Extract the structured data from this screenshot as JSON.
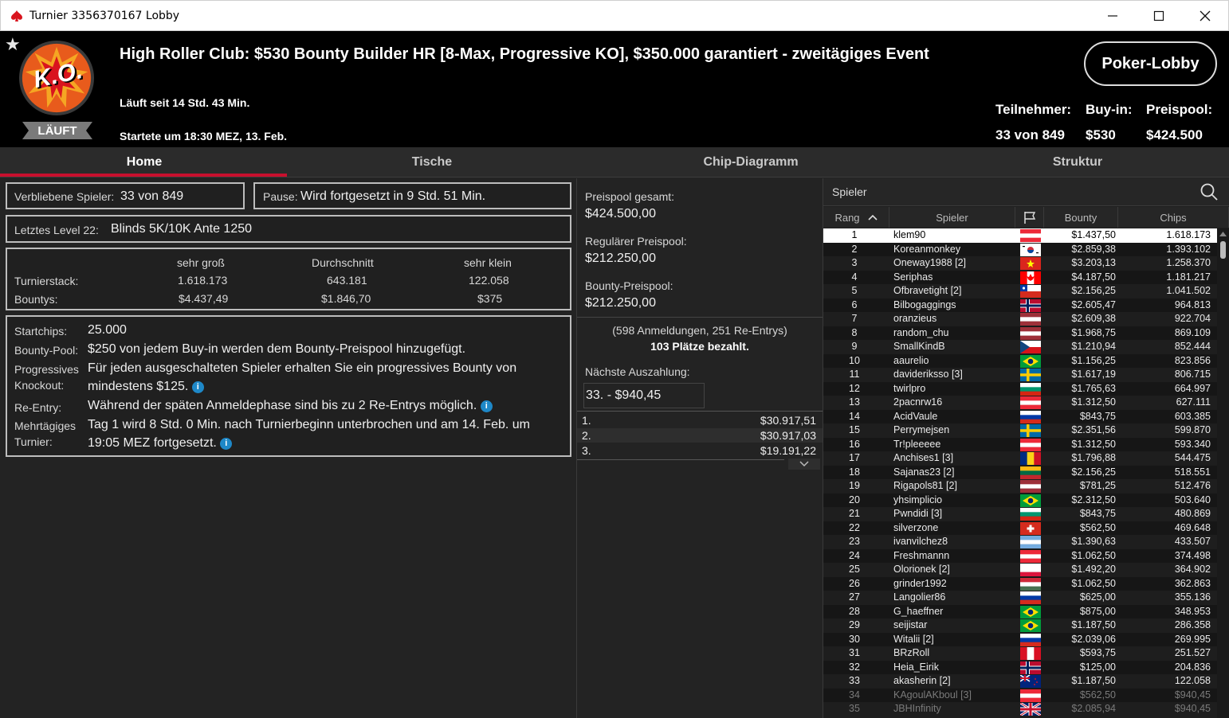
{
  "window": {
    "title": "Turnier 3356370167 Lobby"
  },
  "header": {
    "status": "LÄUFT",
    "title": "High Roller Club: $530 Bounty Builder HR [8-Max, Progressive KO], $350.000 garantiert - zweitägiges Event",
    "running_since": "Läuft seit 14 Std. 43 Min.",
    "started": "Startete um 18:30 MEZ, 13. Feb.",
    "lobby_button": "Poker-Lobby",
    "logo_text": "K.O.",
    "stats": {
      "participants_label": "Teilnehmer:",
      "participants_value": "33 von 849",
      "buyin_label": "Buy-in:",
      "buyin_value": "$530",
      "prizepool_label": "Preispool:",
      "prizepool_value": "$424.500"
    }
  },
  "tabs": [
    "Home",
    "Tische",
    "Chip-Diagramm",
    "Struktur"
  ],
  "home": {
    "remaining_label": "Verbliebene Spieler:",
    "remaining_value": "33 von 849",
    "pause_label": "Pause:",
    "pause_value": "Wird fortgesetzt in 9 Std. 51 Min.",
    "level_label": "Letztes Level 22:",
    "level_value": "Blinds 5K/10K Ante 1250",
    "stack_headers": [
      "sehr groß",
      "Durchschnitt",
      "sehr klein"
    ],
    "stack_label": "Turnierstack:",
    "stack_values": [
      "1.618.173",
      "643.181",
      "122.058"
    ],
    "bounty_label": "Bountys:",
    "bounty_values": [
      "$4.437,49",
      "$1.846,70",
      "$375"
    ],
    "startchips_label": "Startchips:",
    "startchips_value": "25.000",
    "bountypool_label": "Bounty-Pool:",
    "bountypool_value": "$250 von jedem Buy-in werden dem Bounty-Preispool hinzugefügt.",
    "progressive_label_1": "Progressives",
    "progressive_label_2": "Knockout:",
    "progressive_value_1": "Für jeden ausgeschalteten Spieler erhalten Sie ein progressives Bounty von",
    "progressive_value_2": "mindestens $125.",
    "reentry_label": "Re-Entry:",
    "reentry_value": "Während der späten Anmeldephase sind bis zu 2 Re-Entrys möglich.",
    "multiday_label_1": "Mehrtägiges",
    "multiday_label_2": "Turnier:",
    "multiday_value_1": "Tag 1 wird 8 Std. 0 Min. nach Turnierbeginn unterbrochen und am 14. Feb. um",
    "multiday_value_2": "19:05 MEZ fortgesetzt."
  },
  "prizes": {
    "total_label": "Preispool gesamt:",
    "total_value": "$424.500,00",
    "regular_label": "Regulärer Preispool:",
    "regular_value": "$212.250,00",
    "bounty_label": "Bounty-Preispool:",
    "bounty_value": "$212.250,00",
    "registrations": "(598 Anmeldungen, 251 Re-Entrys)",
    "paid_places": "103 Plätze bezahlt.",
    "next_payout_label": "Nächste Auszahlung:",
    "next_payout_value": "33. - $940,45",
    "payouts": [
      {
        "place": "1.",
        "amount": "$30.917,51"
      },
      {
        "place": "2.",
        "amount": "$30.917,03"
      },
      {
        "place": "3.",
        "amount": "$19.191,22"
      }
    ]
  },
  "players": {
    "search_label": "Spieler",
    "columns": [
      "Rang",
      "Spieler",
      "Bounty",
      "Chips"
    ],
    "rows": [
      {
        "rank": "1",
        "name": "klem90",
        "bounty": "$1.437,50",
        "chips": "1.618.173",
        "flag": "at"
      },
      {
        "rank": "2",
        "name": "Koreanmonkey",
        "bounty": "$2.859,38",
        "chips": "1.393.102",
        "flag": "kr"
      },
      {
        "rank": "3",
        "name": "Oneway1988 [2]",
        "bounty": "$3.203,13",
        "chips": "1.258.370",
        "flag": "vn"
      },
      {
        "rank": "4",
        "name": "Seriphas",
        "bounty": "$4.187,50",
        "chips": "1.181.217",
        "flag": "ca"
      },
      {
        "rank": "5",
        "name": "Ofbravetight [2]",
        "bounty": "$2.156,25",
        "chips": "1.041.502",
        "flag": "cl"
      },
      {
        "rank": "6",
        "name": "Bilbogaggings",
        "bounty": "$2.605,47",
        "chips": "964.813",
        "flag": "no"
      },
      {
        "rank": "7",
        "name": "oranzieus",
        "bounty": "$2.609,38",
        "chips": "922.704",
        "flag": "lv"
      },
      {
        "rank": "8",
        "name": "random_chu",
        "bounty": "$1.968,75",
        "chips": "869.109",
        "flag": "lv"
      },
      {
        "rank": "9",
        "name": "SmallKindB",
        "bounty": "$1.210,94",
        "chips": "852.444",
        "flag": "cz"
      },
      {
        "rank": "10",
        "name": "aaurelio",
        "bounty": "$1.156,25",
        "chips": "823.856",
        "flag": "br"
      },
      {
        "rank": "11",
        "name": "davideriksso [3]",
        "bounty": "$1.617,19",
        "chips": "806.715",
        "flag": "se"
      },
      {
        "rank": "12",
        "name": "twirlpro",
        "bounty": "$1.765,63",
        "chips": "664.997",
        "flag": "bg"
      },
      {
        "rank": "13",
        "name": "2pacnrw16",
        "bounty": "$1.312,50",
        "chips": "627.111",
        "flag": "at"
      },
      {
        "rank": "14",
        "name": "AcidVaule",
        "bounty": "$843,75",
        "chips": "603.385",
        "flag": "ru"
      },
      {
        "rank": "15",
        "name": "Perrymejsen",
        "bounty": "$2.351,56",
        "chips": "599.870",
        "flag": "se"
      },
      {
        "rank": "16",
        "name": "Tr!pleeeee",
        "bounty": "$1.312,50",
        "chips": "593.340",
        "flag": "at"
      },
      {
        "rank": "17",
        "name": "Anchises1 [3]",
        "bounty": "$1.796,88",
        "chips": "544.475",
        "flag": "ro"
      },
      {
        "rank": "18",
        "name": "Sajanas23 [2]",
        "bounty": "$2.156,25",
        "chips": "518.551",
        "flag": "lt"
      },
      {
        "rank": "19",
        "name": "Rigapols81 [2]",
        "bounty": "$781,25",
        "chips": "512.476",
        "flag": "lv"
      },
      {
        "rank": "20",
        "name": "yhsimplicio",
        "bounty": "$2.312,50",
        "chips": "503.640",
        "flag": "br"
      },
      {
        "rank": "21",
        "name": "Pwndidi [3]",
        "bounty": "$843,75",
        "chips": "480.869",
        "flag": "bg"
      },
      {
        "rank": "22",
        "name": "silverzone",
        "bounty": "$562,50",
        "chips": "469.648",
        "flag": "ch"
      },
      {
        "rank": "23",
        "name": "ivanvilchez8",
        "bounty": "$1.390,63",
        "chips": "433.507",
        "flag": "ar"
      },
      {
        "rank": "24",
        "name": "Freshmannn",
        "bounty": "$1.062,50",
        "chips": "374.498",
        "flag": "at"
      },
      {
        "rank": "25",
        "name": "Olorionek [2]",
        "bounty": "$1.492,20",
        "chips": "364.902",
        "flag": "pl"
      },
      {
        "rank": "26",
        "name": "grinder1992",
        "bounty": "$1.062,50",
        "chips": "362.863",
        "flag": "hu"
      },
      {
        "rank": "27",
        "name": "Langolier86",
        "bounty": "$625,00",
        "chips": "355.136",
        "flag": "ru"
      },
      {
        "rank": "28",
        "name": "G_haeffner",
        "bounty": "$875,00",
        "chips": "348.953",
        "flag": "br"
      },
      {
        "rank": "29",
        "name": "seijistar",
        "bounty": "$1.187,50",
        "chips": "286.358",
        "flag": "br"
      },
      {
        "rank": "30",
        "name": "Witalii [2]",
        "bounty": "$2.039,06",
        "chips": "269.995",
        "flag": "ru"
      },
      {
        "rank": "31",
        "name": "BRzRoll",
        "bounty": "$593,75",
        "chips": "251.527",
        "flag": "pe"
      },
      {
        "rank": "32",
        "name": "Heia_Eirik",
        "bounty": "$125,00",
        "chips": "204.836",
        "flag": "no"
      },
      {
        "rank": "33",
        "name": "akasherin [2]",
        "bounty": "$1.187,50",
        "chips": "122.058",
        "flag": "nz"
      },
      {
        "rank": "34",
        "name": "KAgoulAKboul [3]",
        "bounty": "$562,50",
        "chips": "$940,45",
        "flag": "at"
      },
      {
        "rank": "35",
        "name": "JBHInfinity",
        "bounty": "$2.085,94",
        "chips": "$940,45",
        "flag": "gb"
      }
    ]
  },
  "colors": {
    "accent": "#c8102e",
    "info": "#1e88c8",
    "selected_row": "#ffffff"
  }
}
